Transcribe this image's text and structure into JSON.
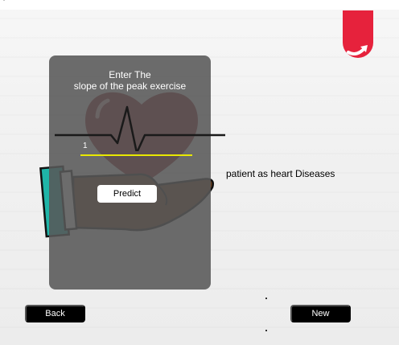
{
  "window": {
    "corner_glyph": "ᵗᵖ"
  },
  "colors": {
    "logo_red": "#e6223c",
    "panel_overlay": "#585858",
    "input_underline": "#e8e800",
    "heart_red": "#8c1d24",
    "button_dark": "#000000",
    "hand_brown": "#6b3f1f",
    "cuff_teal": "#1fb5a8"
  },
  "logo": {
    "icon": "curved-arrow-logo-icon"
  },
  "prompt": {
    "line1": "Enter The",
    "line2": "slope of the peak exercise"
  },
  "input": {
    "value": "1"
  },
  "actions": {
    "predict_label": "Predict",
    "back_label": "Back",
    "new_label": "New"
  },
  "result": {
    "text": "patient as heart Diseases"
  },
  "illustration": {
    "icons": [
      "heart-icon",
      "heartbeat-line-icon",
      "hand-icon",
      "sleeve-cuff-icon"
    ]
  }
}
